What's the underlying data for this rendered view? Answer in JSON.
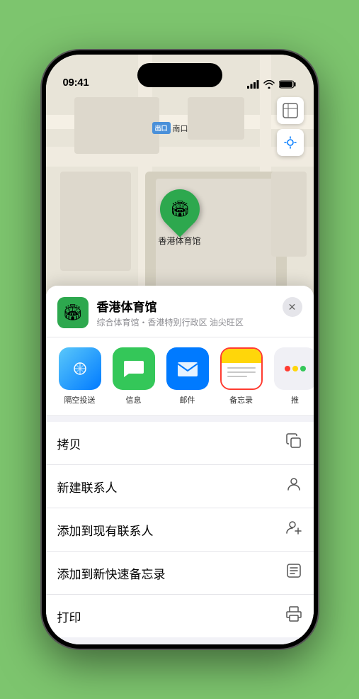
{
  "status_bar": {
    "time": "09:41",
    "signal": "●●●●",
    "wifi": "wifi",
    "battery": "battery"
  },
  "map": {
    "label_box": "出口",
    "label_text": "南口",
    "pin_label": "香港体育馆",
    "controls": {
      "map_icon": "🗺",
      "location_icon": "⊕"
    }
  },
  "location_card": {
    "name": "香港体育馆",
    "description": "综合体育馆・香港特别行政区 油尖旺区",
    "close_label": "×"
  },
  "share_items": [
    {
      "id": "airdrop",
      "label": "隔空投送",
      "type": "airdrop"
    },
    {
      "id": "messages",
      "label": "信息",
      "type": "messages"
    },
    {
      "id": "mail",
      "label": "邮件",
      "type": "mail"
    },
    {
      "id": "notes",
      "label": "备忘录",
      "type": "notes",
      "selected": true
    },
    {
      "id": "more",
      "label": "推",
      "type": "more"
    }
  ],
  "action_items": [
    {
      "id": "copy",
      "label": "拷贝",
      "icon": "copy"
    },
    {
      "id": "new-contact",
      "label": "新建联系人",
      "icon": "person"
    },
    {
      "id": "add-existing",
      "label": "添加到现有联系人",
      "icon": "person-add"
    },
    {
      "id": "add-note",
      "label": "添加到新快速备忘录",
      "icon": "note"
    },
    {
      "id": "print",
      "label": "打印",
      "icon": "print"
    }
  ]
}
